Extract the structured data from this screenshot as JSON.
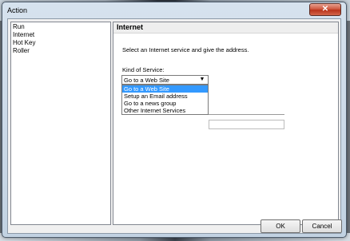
{
  "window": {
    "title": "Action",
    "close_glyph": "✕"
  },
  "nav": {
    "items": [
      {
        "label": "Run"
      },
      {
        "label": "Internet"
      },
      {
        "label": "Hot Key"
      },
      {
        "label": "Roller"
      }
    ]
  },
  "panel": {
    "header": "Internet",
    "instruction": "Select an Internet service and give the address.",
    "kind_label": "Kind of Service:",
    "service_select": {
      "value": "Go to a Web Site",
      "arrow_icon": "chevron-down-icon",
      "options": [
        {
          "label": "Go to a Web Site",
          "selected": true
        },
        {
          "label": "Setup an Email address"
        },
        {
          "label": "Go to a news group"
        },
        {
          "label": "Other Internet Services"
        }
      ]
    }
  },
  "buttons": {
    "ok": "OK",
    "cancel": "Cancel"
  }
}
